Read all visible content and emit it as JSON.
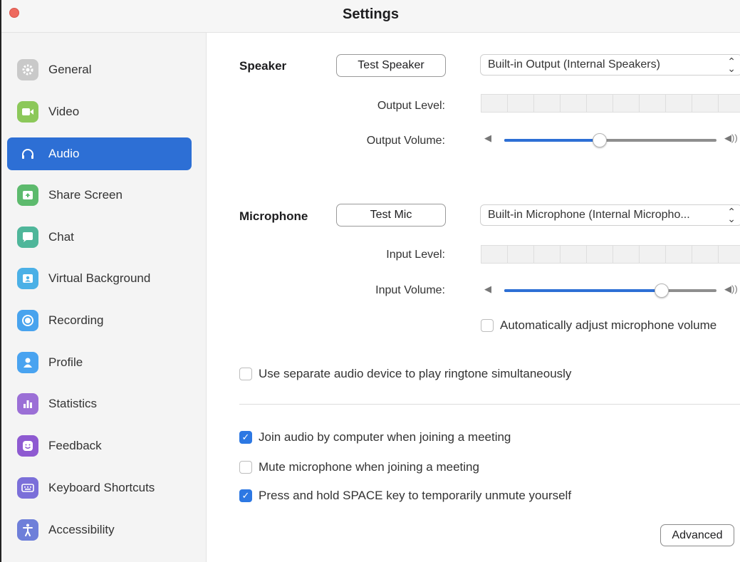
{
  "window": {
    "title": "Settings"
  },
  "sidebar": {
    "items": [
      {
        "label": "General",
        "icon": "gear-icon",
        "color": "#c7c7c7"
      },
      {
        "label": "Video",
        "icon": "video-camera-icon",
        "color": "#8cc85a"
      },
      {
        "label": "Audio",
        "icon": "headphones-icon",
        "color": "#2d6fd5",
        "active": true
      },
      {
        "label": "Share Screen",
        "icon": "share-screen-icon",
        "color": "#5dba6d"
      },
      {
        "label": "Chat",
        "icon": "chat-bubble-icon",
        "color": "#4fb69a"
      },
      {
        "label": "Virtual Background",
        "icon": "person-card-icon",
        "color": "#4bb0e6"
      },
      {
        "label": "Recording",
        "icon": "record-icon",
        "color": "#48a3ee"
      },
      {
        "label": "Profile",
        "icon": "person-icon",
        "color": "#49a3f0"
      },
      {
        "label": "Statistics",
        "icon": "bar-chart-icon",
        "color": "#9b6fd6"
      },
      {
        "label": "Feedback",
        "icon": "smiley-icon",
        "color": "#8e5ad1"
      },
      {
        "label": "Keyboard Shortcuts",
        "icon": "keyboard-icon",
        "color": "#7b6fd9"
      },
      {
        "label": "Accessibility",
        "icon": "accessibility-icon",
        "color": "#6e7fd9"
      }
    ]
  },
  "speaker": {
    "label": "Speaker",
    "test_button": "Test Speaker",
    "device": "Built-in Output (Internal Speakers)",
    "output_level_label": "Output Level:",
    "output_volume_label": "Output Volume:",
    "output_volume": 0.45
  },
  "microphone": {
    "label": "Microphone",
    "test_button": "Test Mic",
    "device": "Built-in Microphone (Internal Micropho...",
    "input_level_label": "Input Level:",
    "input_volume_label": "Input Volume:",
    "input_volume": 0.74,
    "auto_adjust_label": "Automatically adjust microphone volume",
    "auto_adjust_checked": false
  },
  "options": {
    "separate_ringtone_label": "Use separate audio device to play ringtone simultaneously",
    "separate_ringtone_checked": false,
    "join_audio_label": "Join audio by computer when joining a meeting",
    "join_audio_checked": true,
    "mute_mic_label": "Mute microphone when joining a meeting",
    "mute_mic_checked": false,
    "space_unmute_label": "Press and hold SPACE key to temporarily unmute yourself",
    "space_unmute_checked": true
  },
  "advanced_button": "Advanced",
  "colors": {
    "accent": "#2d6fd5",
    "checkbox": "#2d78e3",
    "close": "#ee6a5f"
  }
}
